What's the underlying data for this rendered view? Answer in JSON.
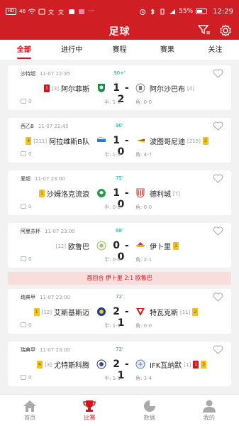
{
  "status_bar": {
    "left_chip1": "HD",
    "left_chip2": "4G",
    "net": "46",
    "battery": "55%",
    "time": "12:29"
  },
  "header": {
    "title": "足球"
  },
  "tabs": [
    "全部",
    "进行中",
    "赛程",
    "赛果",
    "关注"
  ],
  "matches": [
    {
      "league": "沙特超",
      "time": "11-07 22:35",
      "minute": "90+'",
      "home": {
        "name": "阿尔菲斯",
        "rank": "[3]",
        "red": "1"
      },
      "away": {
        "name": "阿尔沙巴布",
        "rank": "[4]"
      },
      "score": "1 - 2",
      "halftime": "半: 1-0",
      "corner": "角: 0-0",
      "count": "0"
    },
    {
      "league": "西乙B",
      "time": "11-07 22:45",
      "minute": "90'",
      "home": {
        "name": "阿拉维斯B队",
        "rank": "[211]",
        "yellow": "4"
      },
      "away": {
        "name": "波图哥尼迪",
        "rank": "[215]",
        "yellow": "2"
      },
      "score": "1 - 0",
      "halftime": "半: 1-0",
      "corner": "角: 4-7",
      "count": "0"
    },
    {
      "league": "爱超",
      "time": "11-07 23:00",
      "minute": "75'",
      "home": {
        "name": "沙姆洛克流浪",
        "rank": "",
        "yellow": "1"
      },
      "away": {
        "name": "德利城",
        "rank": "[7]"
      },
      "score": "1 - 0",
      "halftime": "半: 0-0",
      "corner": "角: 0-0",
      "count": "0"
    },
    {
      "league": "阿曼苏杯",
      "time": "11-07 23:00",
      "minute": "68'",
      "home": {
        "name": "欧鲁巴",
        "rank": "[12]"
      },
      "away": {
        "name": "伊卜里",
        "rank": "",
        "yellow": "1"
      },
      "score": "0 - 0",
      "halftime": "半: 0-0",
      "corner": "角: 2-1",
      "count": "0"
    },
    {
      "league": "瑞典甲",
      "time": "11-07 23:00",
      "minute": "72'",
      "home": {
        "name": "艾斯基斯迈",
        "rank": "[12]",
        "yellow": "1"
      },
      "away": {
        "name": "特瓦克斯",
        "rank": "[11]",
        "yellow": "2"
      },
      "score": "2 - 1",
      "halftime": "半: 1-1",
      "corner": "角: 0-0",
      "count": "0"
    },
    {
      "league": "瑞典甲",
      "time": "11-07 23:00",
      "minute": "73'",
      "home": {
        "name": "尤特斯科腾",
        "rank": "[3]",
        "yellow": "4"
      },
      "away": {
        "name": "IFK瓦纳默",
        "rank": "[1]",
        "red": "1",
        "yellow": "3"
      },
      "score": "2 - 1",
      "halftime": "半: 1-1",
      "corner": "角: 3-4",
      "count": "0"
    }
  ],
  "notice": "首回合 伊卜里 2:1 欧鲁巴",
  "bottom_nav": [
    "首页",
    "比赛",
    "数据",
    "我的"
  ],
  "colors": {
    "brand": "#cf1f24",
    "minute": "#1a9e8b",
    "yellow_card": "#f3c21b",
    "red_card": "#d0161c"
  }
}
